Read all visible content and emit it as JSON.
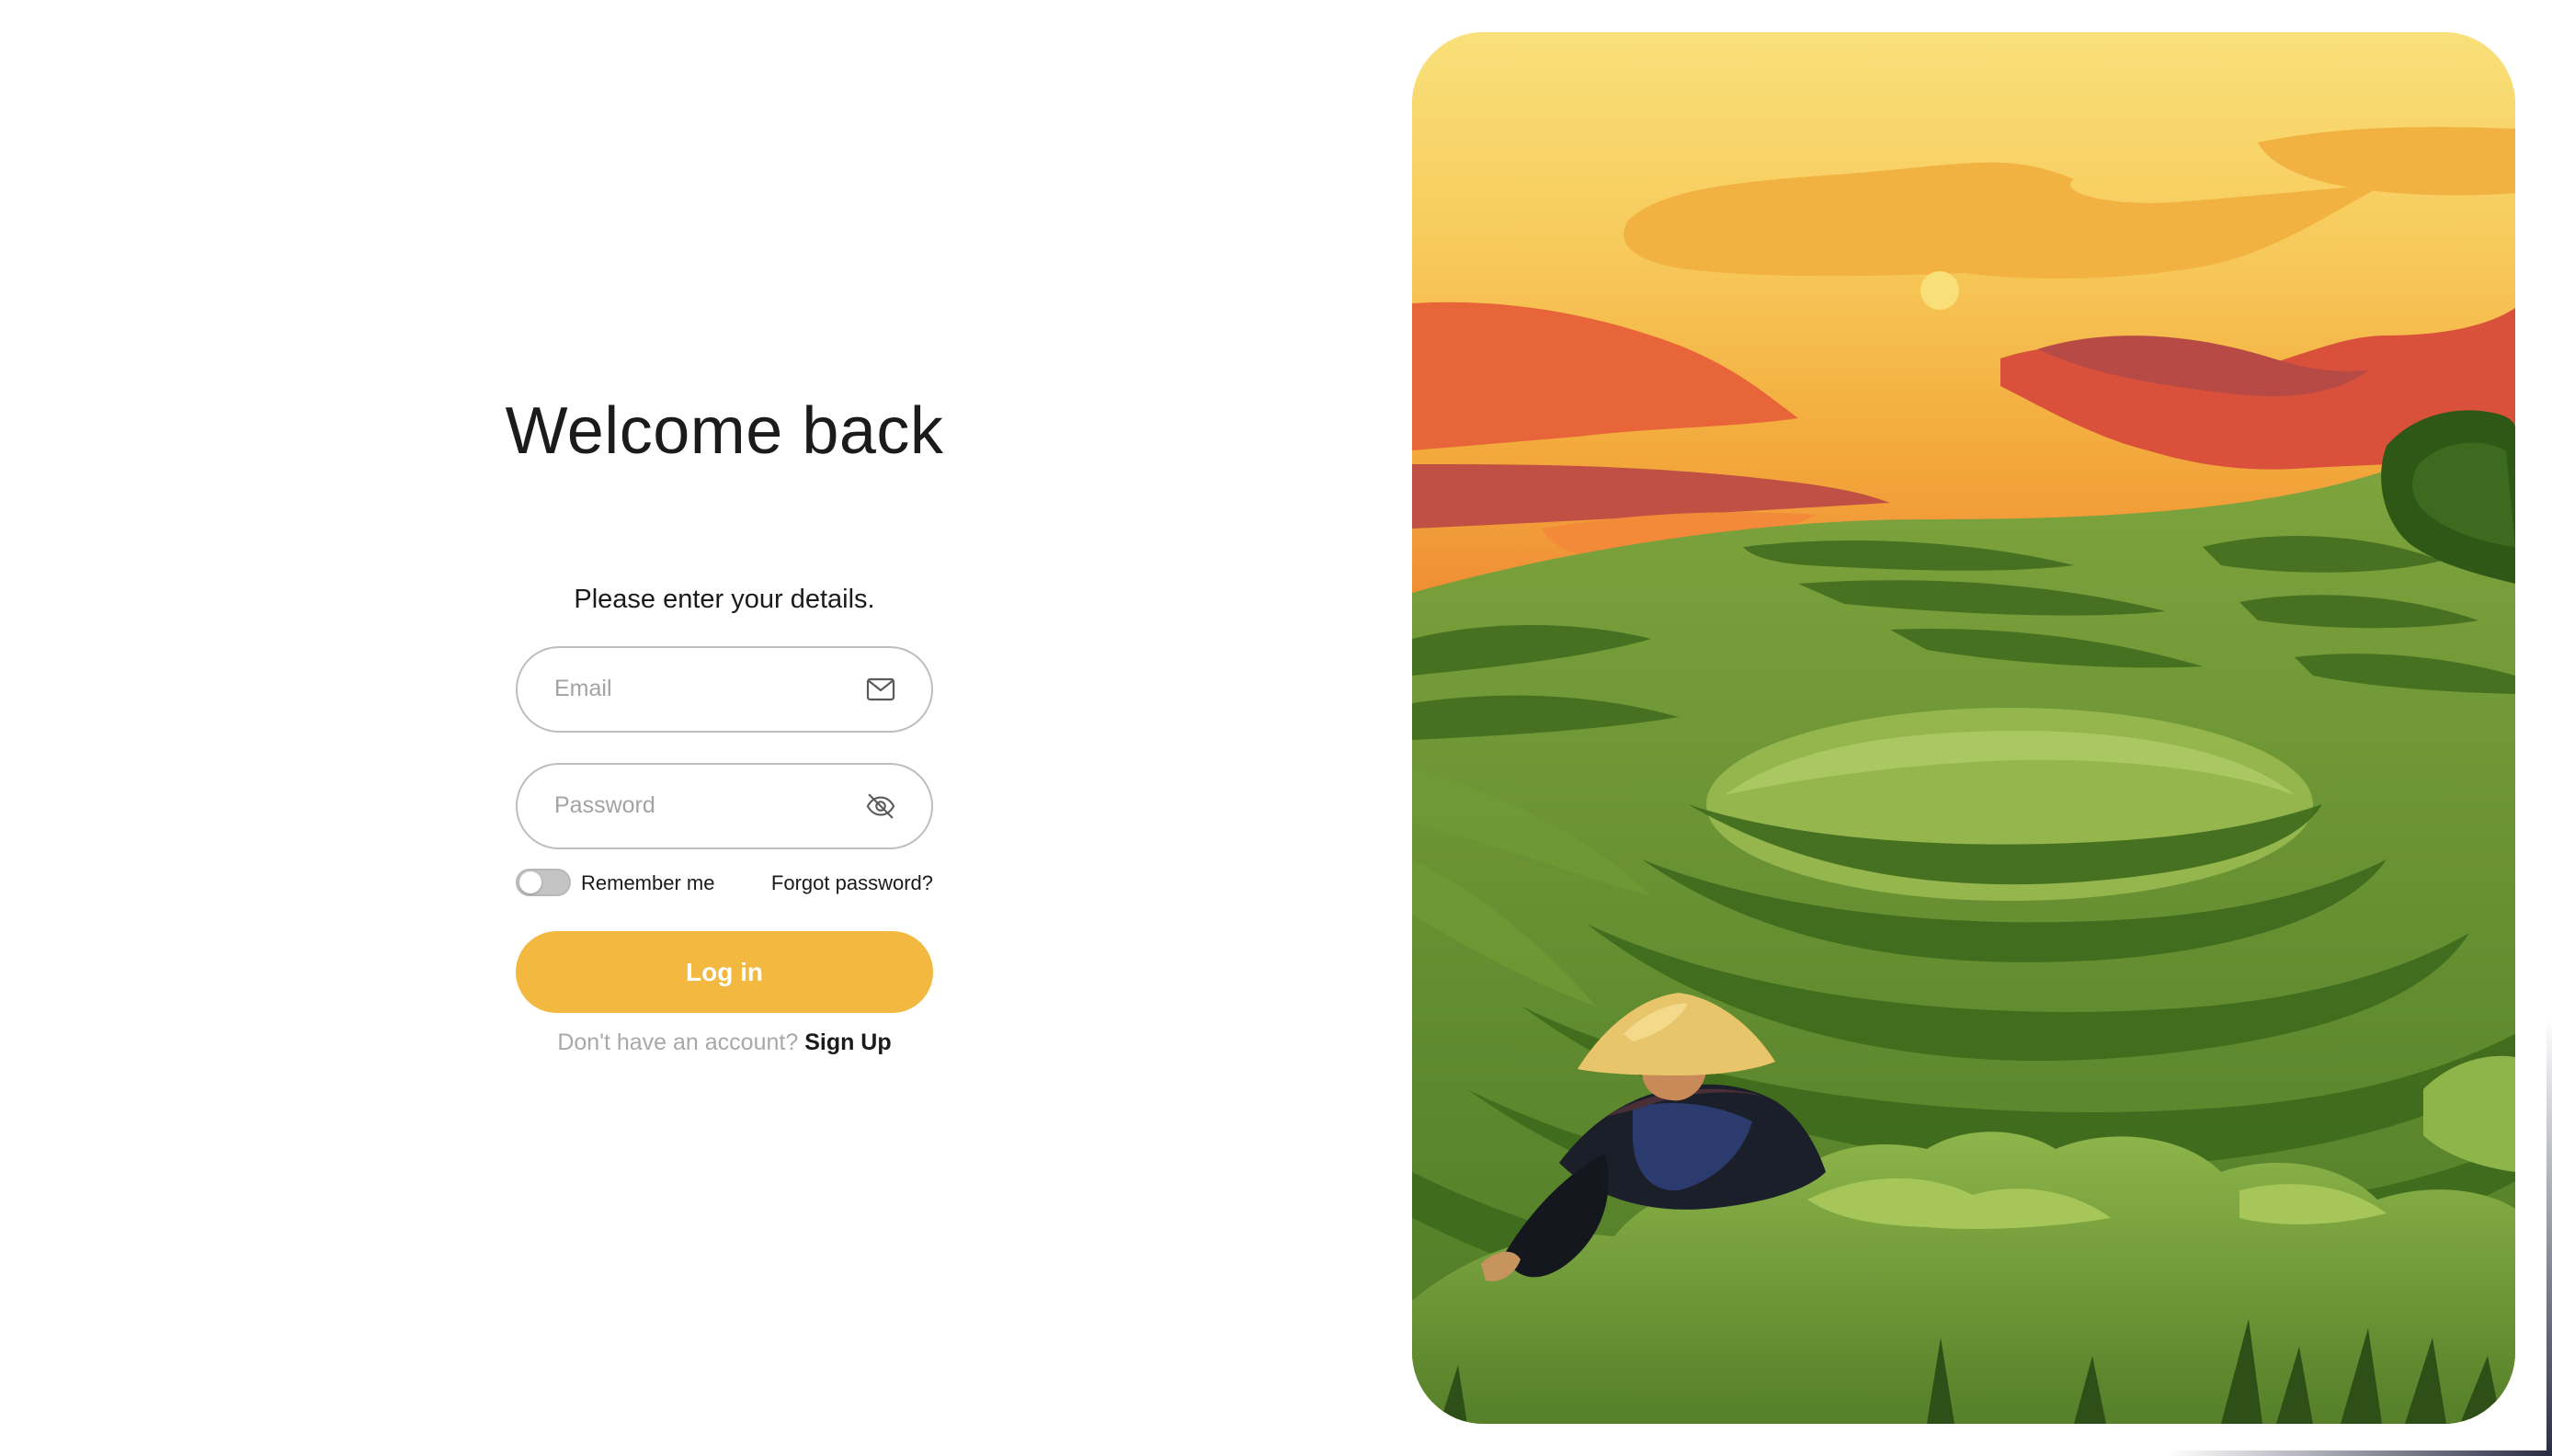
{
  "login": {
    "title": "Welcome back",
    "subtitle": "Please enter your details.",
    "email": {
      "placeholder": "Email",
      "icon": "mail-icon"
    },
    "password": {
      "placeholder": "Password",
      "icon": "eye-off-icon"
    },
    "remember_me": {
      "label": "Remember me",
      "checked": false
    },
    "forgot_password_label": "Forgot password?",
    "login_button_label": "Log in",
    "signup_prompt": "Don't have an account?",
    "signup_link_label": "Sign Up"
  },
  "hero": {
    "icon": "rice-terrace-illustration"
  },
  "colors": {
    "accent": "#f2b840",
    "text": "#1b1b1b",
    "muted_text": "#a8a8a8",
    "input_border": "#bdbdbd",
    "toggle_off": "#c4c4c4"
  }
}
